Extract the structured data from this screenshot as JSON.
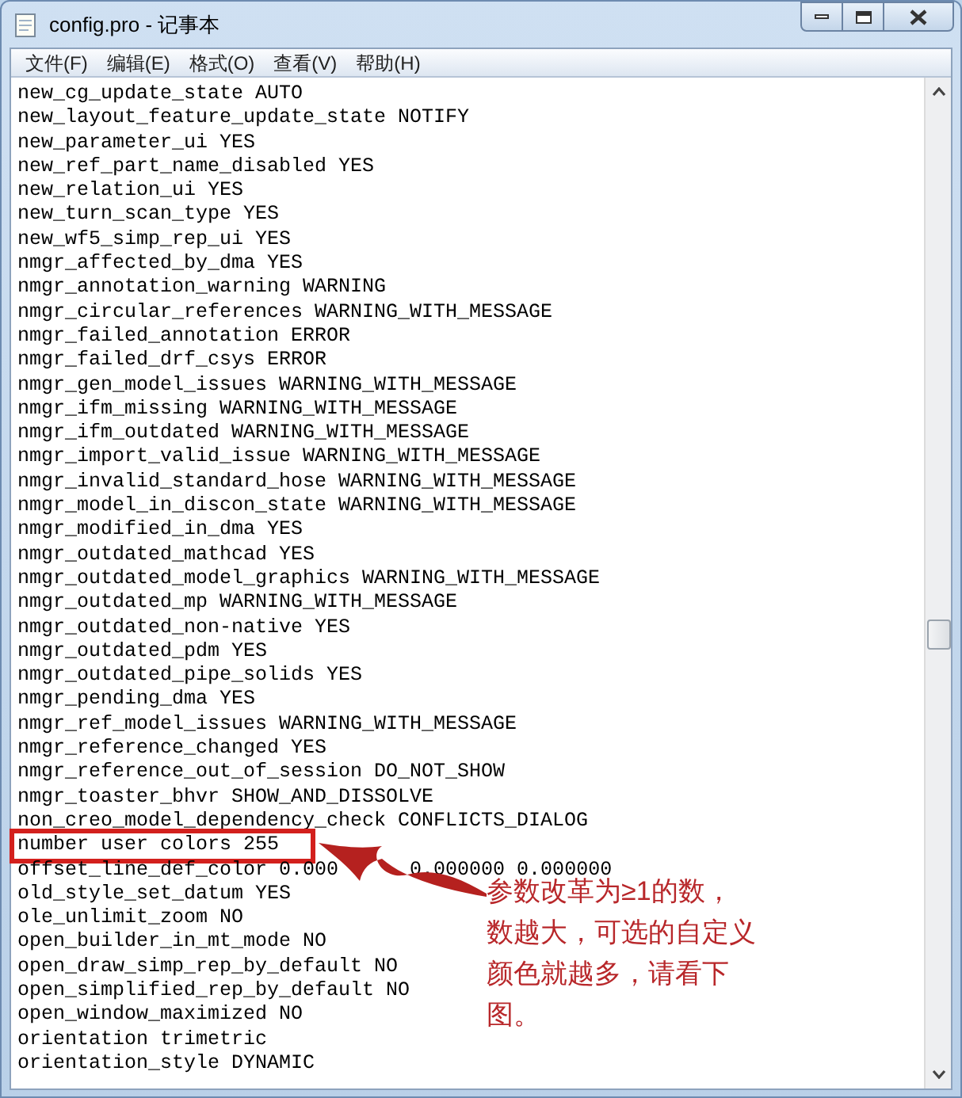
{
  "window": {
    "title": "config.pro - 记事本"
  },
  "menu": [
    "文件(F)",
    "编辑(E)",
    "格式(O)",
    "查看(V)",
    "帮助(H)"
  ],
  "lines": [
    {
      "text": "new_cg_update_state AUTO",
      "highlighted": false
    },
    {
      "text": "new_layout_feature_update_state NOTIFY",
      "highlighted": false
    },
    {
      "text": "new_parameter_ui YES",
      "highlighted": false
    },
    {
      "text": "new_ref_part_name_disabled YES",
      "highlighted": false
    },
    {
      "text": "new_relation_ui YES",
      "highlighted": false
    },
    {
      "text": "new_turn_scan_type YES",
      "highlighted": false
    },
    {
      "text": "new_wf5_simp_rep_ui YES",
      "highlighted": false
    },
    {
      "text": "nmgr_affected_by_dma YES",
      "highlighted": false
    },
    {
      "text": "nmgr_annotation_warning WARNING",
      "highlighted": false
    },
    {
      "text": "nmgr_circular_references WARNING_WITH_MESSAGE",
      "highlighted": false
    },
    {
      "text": "nmgr_failed_annotation ERROR",
      "highlighted": false
    },
    {
      "text": "nmgr_failed_drf_csys ERROR",
      "highlighted": false
    },
    {
      "text": "nmgr_gen_model_issues WARNING_WITH_MESSAGE",
      "highlighted": false
    },
    {
      "text": "nmgr_ifm_missing WARNING_WITH_MESSAGE",
      "highlighted": false
    },
    {
      "text": "nmgr_ifm_outdated WARNING_WITH_MESSAGE",
      "highlighted": false
    },
    {
      "text": "nmgr_import_valid_issue WARNING_WITH_MESSAGE",
      "highlighted": false
    },
    {
      "text": "nmgr_invalid_standard_hose WARNING_WITH_MESSAGE",
      "highlighted": false
    },
    {
      "text": "nmgr_model_in_discon_state WARNING_WITH_MESSAGE",
      "highlighted": false
    },
    {
      "text": "nmgr_modified_in_dma YES",
      "highlighted": false
    },
    {
      "text": "nmgr_outdated_mathcad YES",
      "highlighted": false
    },
    {
      "text": "nmgr_outdated_model_graphics WARNING_WITH_MESSAGE",
      "highlighted": false
    },
    {
      "text": "nmgr_outdated_mp WARNING_WITH_MESSAGE",
      "highlighted": false
    },
    {
      "text": "nmgr_outdated_non-native YES",
      "highlighted": false
    },
    {
      "text": "nmgr_outdated_pdm YES",
      "highlighted": false
    },
    {
      "text": "nmgr_outdated_pipe_solids YES",
      "highlighted": false
    },
    {
      "text": "nmgr_pending_dma YES",
      "highlighted": false
    },
    {
      "text": "nmgr_ref_model_issues WARNING_WITH_MESSAGE",
      "highlighted": false
    },
    {
      "text": "nmgr_reference_changed YES",
      "highlighted": false
    },
    {
      "text": "nmgr_reference_out_of_session DO_NOT_SHOW",
      "highlighted": false
    },
    {
      "text": "nmgr_toaster_bhvr SHOW_AND_DISSOLVE",
      "highlighted": false
    },
    {
      "text": "non_creo_model_dependency_check CONFLICTS_DIALOG",
      "highlighted": false
    },
    {
      "text": "number user colors 255",
      "highlighted": true
    },
    {
      "text": "offset_line_def_color 0.000",
      "text_after_arrow": "0.000000 0.000000",
      "highlighted": false
    },
    {
      "text": "old_style_set_datum YES",
      "highlighted": false
    },
    {
      "text": "ole_unlimit_zoom NO",
      "highlighted": false
    },
    {
      "text": "open_builder_in_mt_mode NO",
      "highlighted": false
    },
    {
      "text": "open_draw_simp_rep_by_default NO",
      "highlighted": false
    },
    {
      "text": "open_simplified_rep_by_default NO",
      "highlighted": false
    },
    {
      "text": "open_window_maximized NO",
      "highlighted": false
    },
    {
      "text": "orientation trimetric",
      "highlighted": false
    },
    {
      "text": "orientation_style DYNAMIC",
      "highlighted": false
    }
  ],
  "annotation": {
    "lines": [
      "参数改革为≥1的数，",
      "数越大，可选的自定义",
      "颜色就越多，请看下",
      "图。"
    ]
  }
}
